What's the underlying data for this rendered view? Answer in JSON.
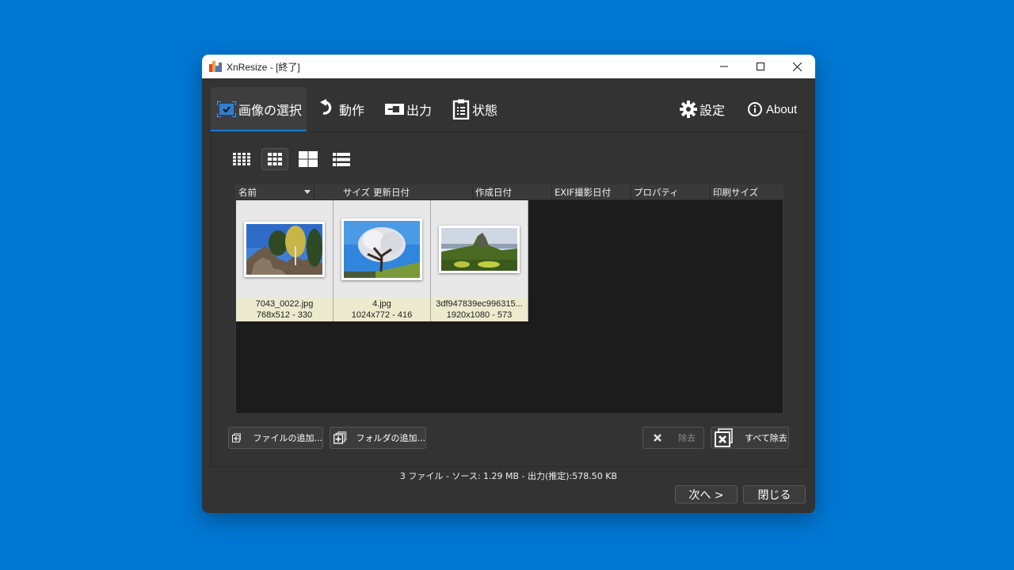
{
  "window": {
    "title": "XnResize - [終了]",
    "controls": {
      "minimize": "minimize",
      "maximize": "maximize",
      "close": "close"
    }
  },
  "tabs": [
    {
      "label": "画像の選択",
      "icon": "image-select-icon",
      "active": true
    },
    {
      "label": "動作",
      "icon": "undo-arrow-icon",
      "active": false
    },
    {
      "label": "出力",
      "icon": "output-icon",
      "active": false
    },
    {
      "label": "状態",
      "icon": "clipboard-icon",
      "active": false
    }
  ],
  "right_tabs": [
    {
      "label": "設定",
      "icon": "gear-icon"
    },
    {
      "label": "About",
      "icon": "info-icon"
    }
  ],
  "view_modes": [
    {
      "name": "small-thumbnails",
      "active": false
    },
    {
      "name": "medium-thumbnails",
      "active": true
    },
    {
      "name": "large-thumbnails",
      "active": false
    },
    {
      "name": "details-list",
      "active": false
    }
  ],
  "columns": [
    "名前",
    "サイズ",
    "更新日付",
    "作成日付",
    "EXIF撮影日付",
    "プロパティ",
    "印刷サイズ"
  ],
  "files": [
    {
      "name": "7043_0022.jpg",
      "info": "768x512 - 330"
    },
    {
      "name": "4.jpg",
      "info": "1024x772 - 416"
    },
    {
      "name": "3df947839ec996315...",
      "info": "1920x1080 - 573"
    }
  ],
  "buttons": {
    "add_files": "ファイルの追加...",
    "add_folder": "フォルダの追加...",
    "remove": "除去",
    "remove_all": "すべて除去"
  },
  "status": "3 ファイル - ソース: 1.29 MB - 出力(推定):578.50 KB",
  "footer": {
    "next": "次へ >",
    "close": "閉じる"
  },
  "colors": {
    "accent": "#1a7fd1",
    "desktop": "#0078d4",
    "window_bg": "#333333",
    "caption_bg": "#ecebce"
  }
}
